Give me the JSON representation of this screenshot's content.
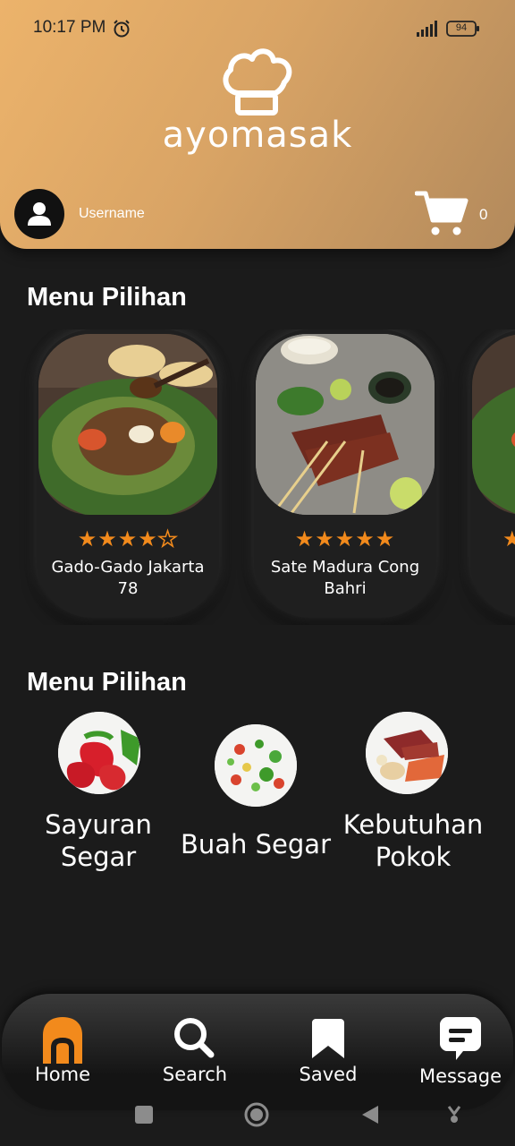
{
  "status_bar": {
    "time": "10:17 PM",
    "battery": "94"
  },
  "header": {
    "app_name": "ayomasak",
    "username": "Username",
    "cart_count": "0"
  },
  "featured": {
    "title": "Menu Pilihan",
    "items": [
      {
        "name": "Gado-Gado Jakarta 78",
        "rating": 4,
        "max_rating": 5
      },
      {
        "name": "Sate Madura Cong Bahri",
        "rating": 5,
        "max_rating": 5
      }
    ]
  },
  "categories": {
    "title": "Menu Pilihan",
    "items": [
      {
        "label_line1": "Sayuran",
        "label_line2": "Segar"
      },
      {
        "label_line1": "Buah Segar",
        "label_line2": ""
      },
      {
        "label_line1": "Kebutuhan",
        "label_line2": "Pokok"
      }
    ]
  },
  "bottom_nav": {
    "items": [
      {
        "label": "Home",
        "icon": "home-icon",
        "active": true
      },
      {
        "label": "Search",
        "icon": "search-icon",
        "active": false
      },
      {
        "label": "Saved",
        "icon": "bookmark-icon",
        "active": false
      },
      {
        "label": "Message",
        "icon": "message-icon",
        "active": false
      }
    ]
  },
  "colors": {
    "accent": "#f28a1c",
    "header_start": "#ecb36b",
    "header_end": "#b38a5c",
    "background": "#1b1b1b"
  }
}
